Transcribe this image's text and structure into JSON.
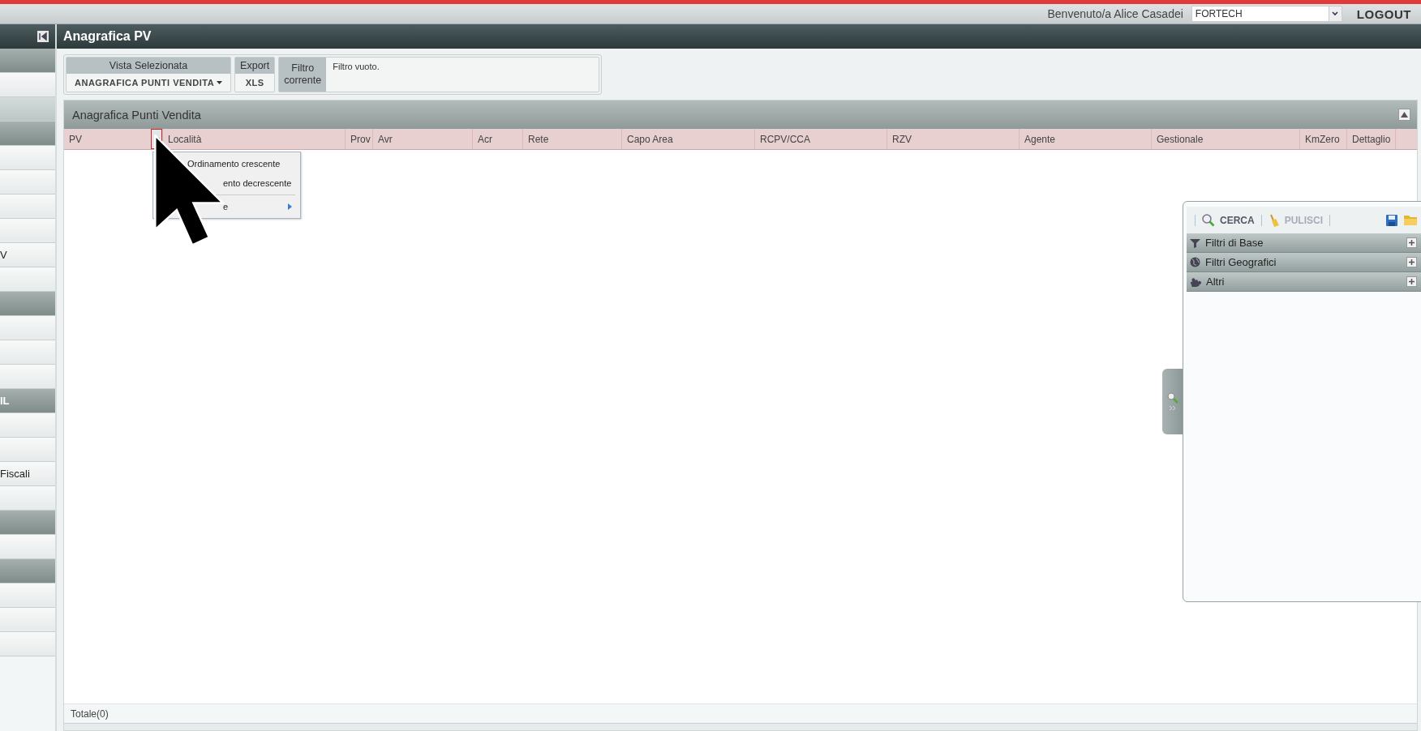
{
  "top_bar": {
    "welcome": "Benvenuto/a Alice Casadei",
    "company_select": "FORTECH",
    "logout": "LOGOUT"
  },
  "sidebar": {
    "items": [
      {
        "kind": "header"
      },
      {
        "kind": "item"
      },
      {
        "kind": "subheader"
      },
      {
        "kind": "header"
      },
      {
        "kind": "item"
      },
      {
        "kind": "item"
      },
      {
        "kind": "item"
      },
      {
        "kind": "item"
      },
      {
        "kind": "item",
        "label": "V"
      },
      {
        "kind": "item"
      },
      {
        "kind": "header"
      },
      {
        "kind": "item"
      },
      {
        "kind": "item"
      },
      {
        "kind": "item"
      },
      {
        "kind": "header",
        "label": "IL"
      },
      {
        "kind": "item"
      },
      {
        "kind": "item"
      },
      {
        "kind": "item",
        "label": "Fiscali"
      },
      {
        "kind": "item"
      },
      {
        "kind": "header"
      },
      {
        "kind": "item"
      },
      {
        "kind": "header"
      },
      {
        "kind": "item"
      },
      {
        "kind": "item"
      },
      {
        "kind": "item"
      }
    ]
  },
  "page": {
    "title": "Anagrafica PV"
  },
  "toolbar": {
    "view": {
      "label": "Vista Selezionata",
      "value": "ANAGRAFICA PUNTI VENDITA"
    },
    "export": {
      "label": "Export",
      "value": "XLS"
    },
    "filter": {
      "label": "Filtro corrente",
      "value": "Filtro vuoto."
    }
  },
  "grid": {
    "title": "Anagrafica Punti Vendita",
    "collapsed": false,
    "columns": [
      {
        "label": "PV",
        "menu_open": true
      },
      {
        "label": "Località",
        "menu_open": false
      },
      {
        "label": "Prov",
        "menu_open": false
      },
      {
        "label": "Avr",
        "menu_open": false
      },
      {
        "label": "Acr",
        "menu_open": false
      },
      {
        "label": "Rete",
        "menu_open": false
      },
      {
        "label": "Capo Area",
        "menu_open": false
      },
      {
        "label": "RCPV/CCA",
        "menu_open": false
      },
      {
        "label": "RZV",
        "menu_open": false
      },
      {
        "label": "Agente",
        "menu_open": false
      },
      {
        "label": "Gestionale",
        "menu_open": false
      },
      {
        "label": "KmZero",
        "menu_open": false
      },
      {
        "label": "Dettaglio",
        "menu_open": false
      }
    ],
    "footer": "Totale(0)"
  },
  "column_menu": {
    "items": [
      {
        "label": "Ordinamento crescente",
        "under_pointer": false,
        "submenu": false
      },
      {
        "label": "ento decrescente",
        "under_pointer": true,
        "submenu": false
      },
      {
        "label": "e",
        "under_pointer": true,
        "submenu": true
      }
    ]
  },
  "filter_panel": {
    "actions": [
      {
        "label": "CERCA",
        "disabled": false
      },
      {
        "label": "PULISCI",
        "disabled": true
      }
    ],
    "sections": [
      {
        "label": "Filtri di Base",
        "expanded": false
      },
      {
        "label": "Filtri Geografici",
        "expanded": false
      },
      {
        "label": "Altri",
        "expanded": false
      }
    ]
  }
}
